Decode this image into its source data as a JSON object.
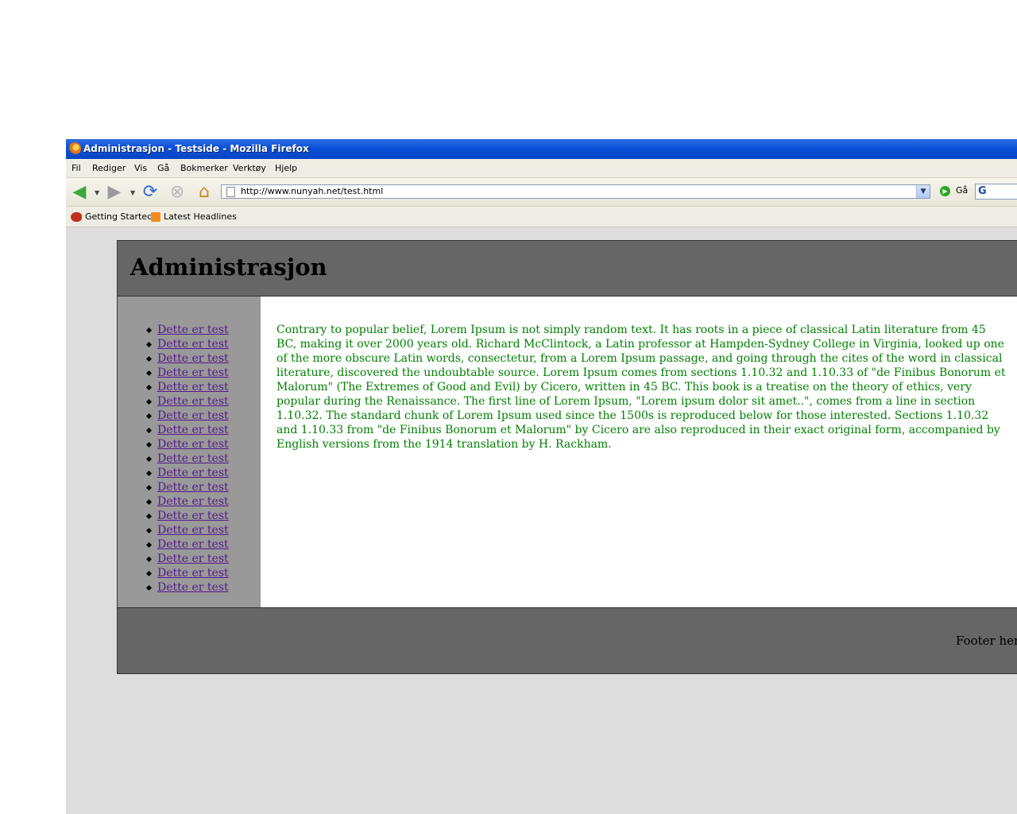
{
  "window": {
    "title": "Administrasjon - Testside - Mozilla Firefox"
  },
  "menu": [
    "Fil",
    "Rediger",
    "Vis",
    "Gå",
    "Bokmerker",
    "Verktøy",
    "Hjelp"
  ],
  "toolbar": {
    "url": "http://www.nunyah.net/test.html",
    "go_label": "Gå",
    "search_logo": "G"
  },
  "bookmarks": [
    "Getting Started",
    "Latest Headlines"
  ],
  "page": {
    "title": "Administrasjon",
    "nav_items": [
      "Dette er test",
      "Dette er test",
      "Dette er test",
      "Dette er test",
      "Dette er test",
      "Dette er test",
      "Dette er test",
      "Dette er test",
      "Dette er test",
      "Dette er test",
      "Dette er test",
      "Dette er test",
      "Dette er test",
      "Dette er test",
      "Dette er test",
      "Dette er test",
      "Dette er test",
      "Dette er test",
      "Dette er test"
    ],
    "body_text": "Contrary to popular belief, Lorem Ipsum is not simply random text. It has roots in a piece of classical Latin literature from 45 BC, making it over 2000 years old. Richard McClintock, a Latin professor at Hampden-Sydney College in Virginia, looked up one of the more obscure Latin words, consectetur, from a Lorem Ipsum passage, and going through the cites of the word in classical literature, discovered the undoubtable source. Lorem Ipsum comes from sections 1.10.32 and 1.10.33 of \"de Finibus Bonorum et Malorum\" (The Extremes of Good and Evil) by Cicero, written in 45 BC. This book is a treatise on the theory of ethics, very popular during the Renaissance. The first line of Lorem Ipsum, \"Lorem ipsum dolor sit amet..\", comes from a line in section 1.10.32. The standard chunk of Lorem Ipsum used since the 1500s is reproduced below for those interested. Sections 1.10.32 and 1.10.33 from \"de Finibus Bonorum et Malorum\" by Cicero are also reproduced in their exact original form, accompanied by English versions from the 1914 translation by H. Rackham.",
    "footer": "Footer here."
  }
}
